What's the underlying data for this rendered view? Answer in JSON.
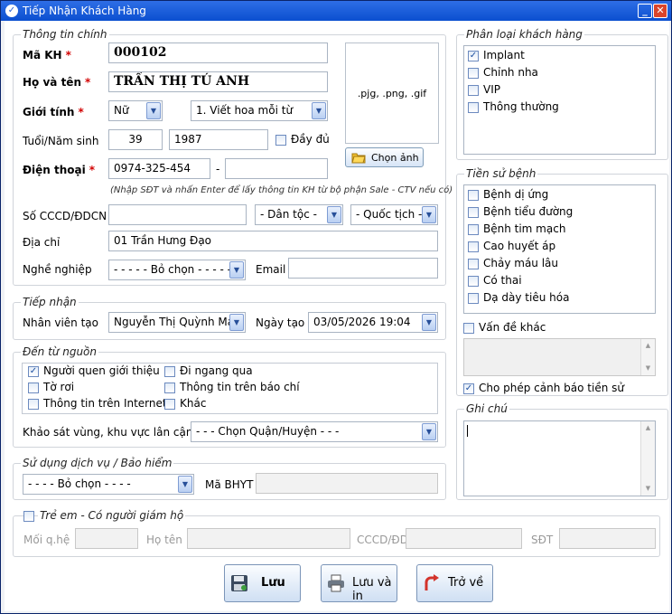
{
  "window": {
    "title": "Tiếp Nhận Khách Hàng"
  },
  "customer_info": {
    "group_title": "Thông tin chính",
    "code_label": "Mã KH",
    "code_value": "000102",
    "name_label": "Họ và tên",
    "name_value": "TRẦN THỊ TÚ ANH",
    "gender_label": "Giới tính",
    "gender_value": "Nữ",
    "case_value": "1. Viết hoa mỗi từ",
    "age_label": "Tuổi/Năm sinh",
    "age_value": "39",
    "birth_year_value": "1987",
    "full_label": "Đầy đủ",
    "phone_label": "Điện thoại",
    "phone_value": "0974-325-454",
    "phone_sep": "-",
    "phone_hint": "(Nhập SĐT và nhấn Enter để lấy thông tin KH từ bộ phận Sale - CTV nếu có)",
    "id_label": "Số CCCD/ĐDCN",
    "ethnicity_value": "- Dân tộc -",
    "nationality_value": "- Quốc tịch -",
    "address_label": "Địa chỉ",
    "address_value": "01 Trần Hưng Đạo",
    "job_label": "Nghề nghiệp",
    "job_value": "- - - - - Bỏ chọn - - - - -",
    "email_label": "Email",
    "photo_placeholder": ".pjg, .png, .gif",
    "choose_photo_label": "Chọn ảnh"
  },
  "reception": {
    "group_title": "Tiếp nhận",
    "staff_label": "Nhân viên tạo",
    "staff_value": "Nguyễn Thị Quỳnh Mai",
    "date_label": "Ngày tạo",
    "date_value": "03/05/2026 19:04"
  },
  "source": {
    "group_title": "Đến từ nguồn",
    "options": [
      {
        "label": "Người quen giới thiệu",
        "checked": true
      },
      {
        "label": "Đi ngang qua",
        "checked": false
      },
      {
        "label": "Tờ rơi",
        "checked": false
      },
      {
        "label": "Thông tin trên báo chí",
        "checked": false
      },
      {
        "label": "Thông tin trên Internet",
        "checked": false
      },
      {
        "label": "Khác",
        "checked": false
      }
    ],
    "survey_label": "Khảo sát vùng, khu vực lân cận",
    "survey_value": "- - - Chọn Quận/Huyện - - -"
  },
  "insurance": {
    "group_title": "Sử dụng dịch vụ / Bảo hiểm",
    "service_value": "- - - - Bỏ chọn - - - -",
    "bhyt_label": "Mã BHYT"
  },
  "guardian": {
    "group_title": "Trẻ em - Có người giám hộ",
    "relation_label": "Mối q.hệ",
    "name_label": "Họ tên",
    "id_label": "CCCD/ĐD",
    "phone_label": "SĐT"
  },
  "classification": {
    "group_title": "Phân loại khách hàng",
    "items": [
      {
        "label": "Implant",
        "checked": true
      },
      {
        "label": "Chỉnh nha",
        "checked": false
      },
      {
        "label": "VIP",
        "checked": false
      },
      {
        "label": "Thông thường",
        "checked": false
      }
    ]
  },
  "history": {
    "group_title": "Tiền sử bệnh",
    "items": [
      {
        "label": "Bệnh dị ứng",
        "checked": false
      },
      {
        "label": "Bệnh tiểu đường",
        "checked": false
      },
      {
        "label": "Bệnh tim mạch",
        "checked": false
      },
      {
        "label": "Cao huyết áp",
        "checked": false
      },
      {
        "label": "Chảy máu lâu",
        "checked": false
      },
      {
        "label": "Có thai",
        "checked": false
      },
      {
        "label": "Dạ dày tiêu hóa",
        "checked": false
      }
    ],
    "other_label": "Vấn đề khác",
    "warn_label": "Cho phép cảnh báo tiền sử"
  },
  "notes": {
    "group_title": "Ghi chú"
  },
  "buttons": {
    "save": "Lưu",
    "save_print": "Lưu và in",
    "back": "Trở về"
  },
  "colors": {
    "title_bar": "#0b4fd0",
    "required": "#d20000"
  }
}
